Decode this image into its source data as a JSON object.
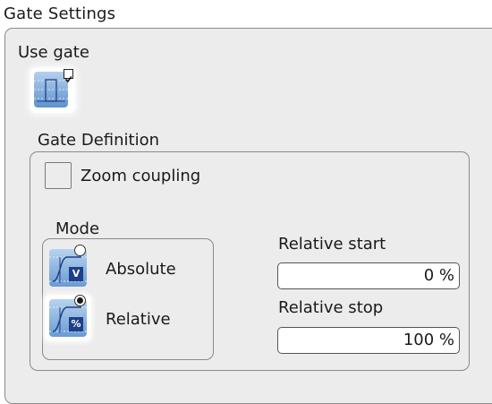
{
  "panel": {
    "title": "Gate Settings"
  },
  "use_gate": {
    "label": "Use gate",
    "checked": true,
    "icon": "gate-toggle-icon",
    "icon_color": "#5f92cb"
  },
  "gate_definition": {
    "title": "Gate Definition",
    "zoom_coupling": {
      "label": "Zoom coupling",
      "checked": false
    },
    "mode": {
      "title": "Mode",
      "selected": "Relative",
      "options": [
        {
          "label": "Absolute",
          "icon": "absolute-mode-icon",
          "unit": "V",
          "selected": false
        },
        {
          "label": "Relative",
          "icon": "relative-mode-icon",
          "unit": "%",
          "selected": true
        }
      ]
    },
    "relative_start": {
      "label": "Relative start",
      "value": "0 %"
    },
    "relative_stop": {
      "label": "Relative stop",
      "value": "100 %"
    }
  },
  "colors": {
    "frame_background": "#ececec",
    "frame_border": "#8a8a8a",
    "icon_blue": "#5f92cb",
    "unit_badge": "#1d3f8a"
  }
}
